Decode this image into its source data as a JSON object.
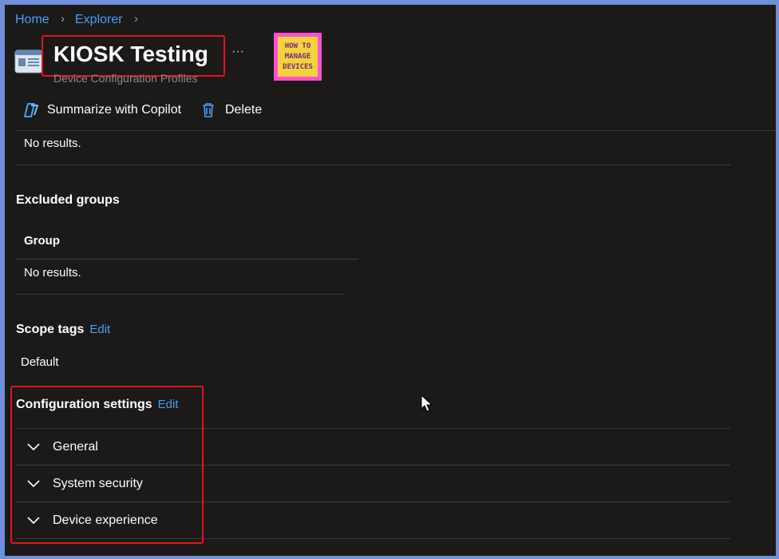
{
  "breadcrumb": {
    "items": [
      "Home",
      "Explorer"
    ]
  },
  "header": {
    "title": "KIOSK Testing",
    "subtitle": "Device Configuration Profiles",
    "more": "···",
    "logo_lines": [
      "HOW TO",
      "MANAGE",
      "DEVICES"
    ]
  },
  "toolbar": {
    "summarize_label": "Summarize with Copilot",
    "delete_label": "Delete"
  },
  "included": {
    "no_results": "No results."
  },
  "excluded_groups": {
    "title": "Excluded groups",
    "column_header": "Group",
    "no_results": "No results."
  },
  "scope_tags": {
    "title": "Scope tags",
    "edit": "Edit",
    "value": "Default"
  },
  "configuration_settings": {
    "title": "Configuration settings",
    "edit": "Edit",
    "sections": [
      "General",
      "System security",
      "Device experience"
    ]
  },
  "colors": {
    "background": "#1b1a19",
    "link": "#479ef5",
    "highlight": "#e81123",
    "logo_bg": "#ff4fcf"
  }
}
